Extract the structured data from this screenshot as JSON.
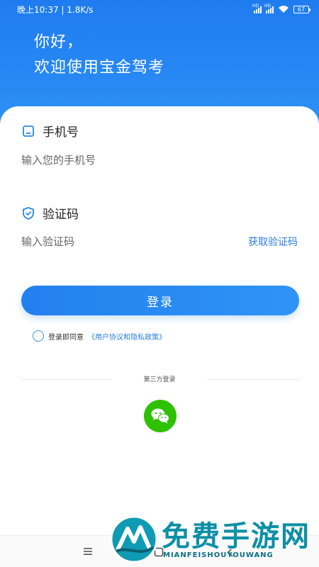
{
  "status": {
    "time_speed": "晚上10:37 | 1.8K/s",
    "sig1_badge": "HD",
    "sig2_badge": "HD",
    "battery": "67"
  },
  "greeting": {
    "line1": "你好，",
    "line2": "欢迎使用宝金驾考"
  },
  "phone": {
    "label": "手机号",
    "placeholder": "输入您的手机号"
  },
  "code": {
    "label": "验证码",
    "placeholder": "输入验证码",
    "get_code": "获取验证码"
  },
  "login": {
    "label": "登录"
  },
  "agreement": {
    "prefix": "登录即同意",
    "link": "《用户协议和隐私政策》"
  },
  "third_party": {
    "label": "第三方登录"
  },
  "watermark": {
    "title": "免费手游网",
    "subtitle": "MIANFEISHOUYOUWANG"
  },
  "colors": {
    "primary": "#2280ee",
    "link": "#2a7de1",
    "wechat": "#2dc100"
  }
}
